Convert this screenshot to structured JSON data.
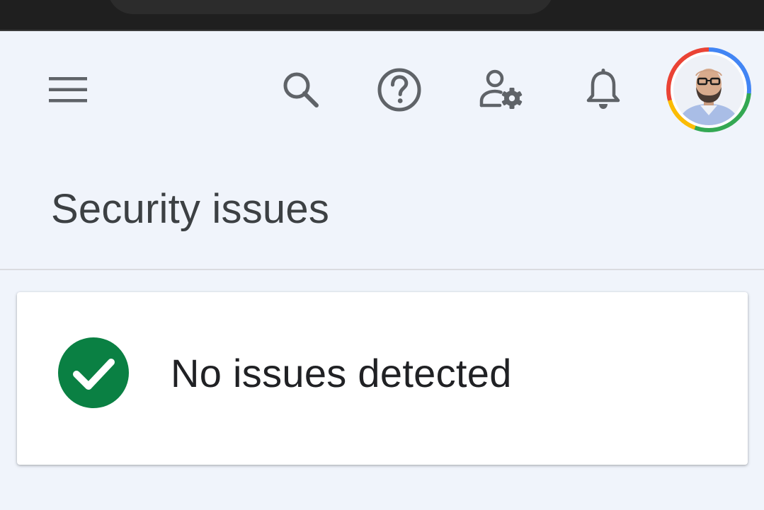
{
  "icons": {
    "menu": "menu-icon",
    "search": "search-icon",
    "help": "help-circle-icon",
    "admin": "user-gear-icon",
    "notifications": "bell-icon",
    "avatar": "account-avatar",
    "status": "check-circle-icon"
  },
  "page": {
    "title": "Security issues"
  },
  "status_card": {
    "message": "No issues detected"
  },
  "colors": {
    "background": "#f0f4fb",
    "icon": "#5f6368",
    "title": "#3c4043",
    "success": "#0a8043",
    "avatar_ring": [
      "#4285f4",
      "#34a853",
      "#fbbc05",
      "#ea4335"
    ]
  }
}
